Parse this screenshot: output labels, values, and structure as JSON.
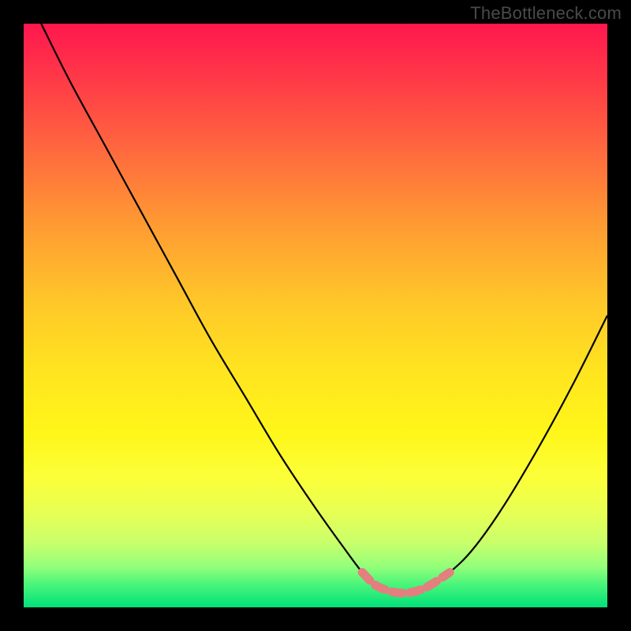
{
  "watermark": "TheBottleneck.com",
  "colors": {
    "page_bg": "#000000",
    "gradient_top": "#ff174e",
    "gradient_bottom": "#00e17a",
    "curve": "#000000",
    "min_marker": "#e37f7f",
    "watermark": "#4a4a4a"
  },
  "chart_data": {
    "type": "line",
    "title": "",
    "xlabel": "",
    "ylabel": "",
    "xlim": [
      0,
      100
    ],
    "ylim": [
      0,
      100
    ],
    "grid": false,
    "legend": false,
    "series": [
      {
        "name": "bottleneck-curve",
        "x": [
          3,
          8,
          14,
          20,
          26,
          32,
          38,
          44,
          50,
          55,
          58,
          60,
          62,
          64,
          66,
          68,
          70,
          73,
          77,
          82,
          88,
          94,
          100
        ],
        "y": [
          100,
          90,
          79,
          68,
          57,
          46,
          36,
          26,
          17,
          10,
          6,
          4,
          3,
          2.5,
          2.5,
          3,
          4,
          6,
          10,
          17,
          27,
          38,
          50
        ]
      }
    ],
    "annotations": [
      {
        "name": "minimum-region",
        "x_range": [
          58,
          72
        ],
        "y_approx": 3,
        "style": "dashed-pink"
      }
    ]
  }
}
